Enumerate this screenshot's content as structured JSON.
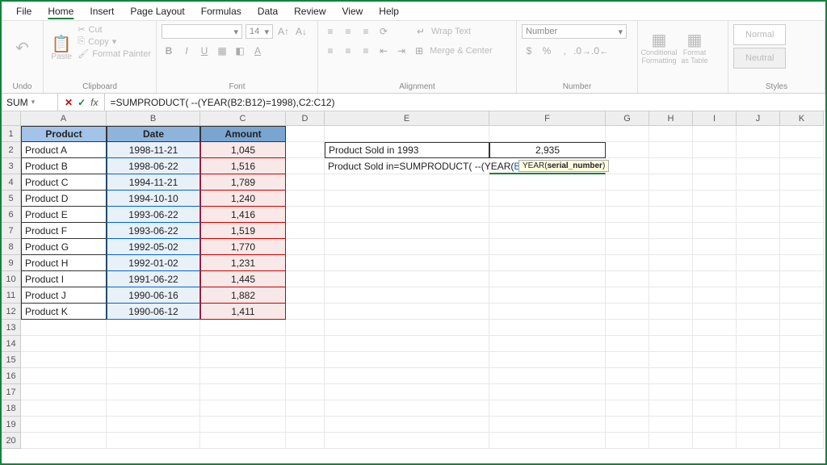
{
  "menu": {
    "tabs": [
      "File",
      "Home",
      "Insert",
      "Page Layout",
      "Formulas",
      "Data",
      "Review",
      "View",
      "Help"
    ],
    "active": 1
  },
  "ribbon": {
    "undo": {
      "label": "Undo"
    },
    "clipboard": {
      "label": "Clipboard",
      "paste": "Paste",
      "cut": "Cut",
      "copy": "Copy",
      "fmtPainter": "Format Painter"
    },
    "font": {
      "label": "Font",
      "size": "14",
      "btns": [
        "B",
        "I",
        "U"
      ]
    },
    "alignment": {
      "label": "Alignment",
      "wrap": "Wrap Text",
      "merge": "Merge & Center"
    },
    "number": {
      "label": "Number",
      "format": "Number"
    },
    "styles": {
      "label": "Styles",
      "cond": "Conditional Formatting",
      "tbl": "Format as Table",
      "normal": "Normal",
      "neutral": "Neutral"
    }
  },
  "formulaBar": {
    "nameBox": "SUM",
    "formula": "=SUMPRODUCT( --(YEAR(B2:B12)=1998),C2:C12)"
  },
  "cols": [
    "A",
    "B",
    "C",
    "D",
    "E",
    "F",
    "G",
    "H",
    "I",
    "J",
    "K"
  ],
  "rowCount": 20,
  "headers": {
    "A": "Product",
    "B": "Date",
    "C": "Amount"
  },
  "data": [
    {
      "p": "Product A",
      "d": "1998-11-21",
      "a": "1,045"
    },
    {
      "p": "Product B",
      "d": "1998-06-22",
      "a": "1,516"
    },
    {
      "p": "Product C",
      "d": "1994-11-21",
      "a": "1,789"
    },
    {
      "p": "Product D",
      "d": "1994-10-10",
      "a": "1,240"
    },
    {
      "p": "Product E",
      "d": "1993-06-22",
      "a": "1,416"
    },
    {
      "p": "Product F",
      "d": "1993-06-22",
      "a": "1,519"
    },
    {
      "p": "Product G",
      "d": "1992-05-02",
      "a": "1,770"
    },
    {
      "p": "Product H",
      "d": "1992-01-02",
      "a": "1,231"
    },
    {
      "p": "Product I",
      "d": "1991-06-22",
      "a": "1,445"
    },
    {
      "p": "Product J",
      "d": "1990-06-16",
      "a": "1,882"
    },
    {
      "p": "Product K",
      "d": "1990-06-12",
      "a": "1,411"
    }
  ],
  "side": {
    "r2e": "Product Sold in 1993",
    "r2f": "2,935",
    "r3e": "Product Sold in",
    "r3f_pre": "=SUMPRODUCT( --(YEAR(",
    "r3f_b": "B2:B12",
    "r3f_mid": ")=1998),",
    "r3f_c": "C2:C12",
    "r3f_end": ")"
  },
  "tooltip": {
    "fn": "YEAR(",
    "arg": "serial_number",
    "end": ")"
  },
  "icons": {
    "scissors": "✂",
    "copy": "⎘",
    "brush": "🖌",
    "dd": "▾"
  }
}
